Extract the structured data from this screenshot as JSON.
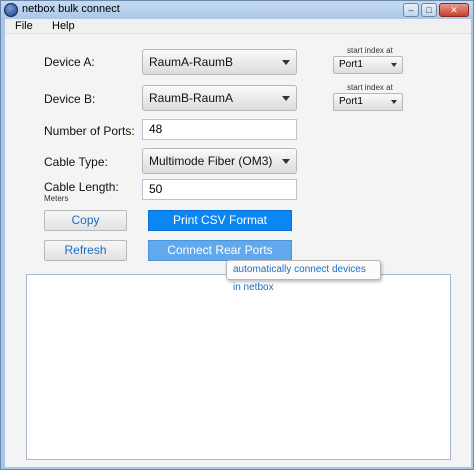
{
  "window": {
    "title": "netbox bulk connect",
    "min_glyph": "–",
    "max_glyph": "□",
    "close_glyph": "✕"
  },
  "menu": {
    "items": [
      "File",
      "Help"
    ]
  },
  "form": {
    "device_a": {
      "label": "Device A:",
      "value": "RaumA-RaumB"
    },
    "device_b": {
      "label": "Device B:",
      "value": "RaumB-RaumA"
    },
    "start_index_a": {
      "label": "start index at",
      "value": "Port1"
    },
    "start_index_b": {
      "label": "start index at",
      "value": "Port1"
    },
    "num_ports": {
      "label": "Number of Ports:",
      "value": "48"
    },
    "cable_type": {
      "label": "Cable Type:",
      "value": "Multimode Fiber (OM3)"
    },
    "cable_length": {
      "label": "Cable Length:",
      "sublabel": "Meters",
      "value": "50"
    }
  },
  "buttons": {
    "copy": "Copy",
    "print_csv": "Print CSV Format",
    "refresh": "Refresh",
    "connect_rear": "Connect Rear Ports"
  },
  "tooltip": {
    "text": "automatically connect devices in netbox"
  },
  "output": {
    "text": ""
  }
}
